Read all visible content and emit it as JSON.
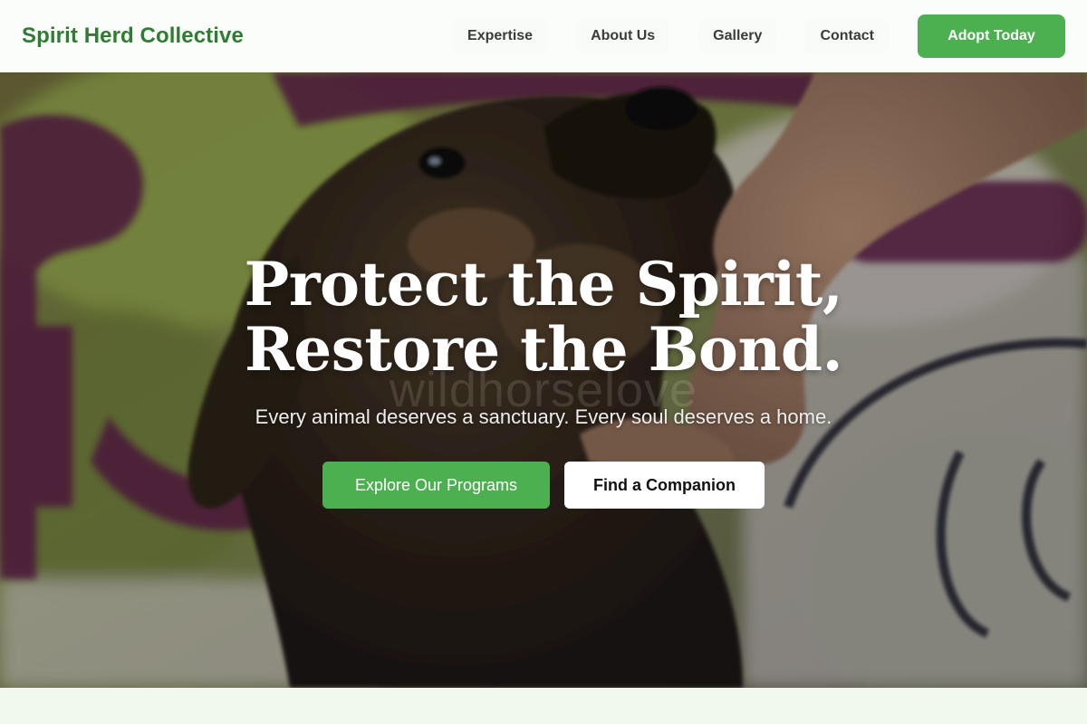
{
  "header": {
    "brand": "Spirit Herd Collective",
    "nav": [
      "Expertise",
      "About Us",
      "Gallery",
      "Contact"
    ],
    "cta_label": "Adopt Today"
  },
  "hero": {
    "title_line1": "Protect the Spirit,",
    "title_line2": "Restore the Bond.",
    "watermark": "wildhorselove",
    "subtitle": "Every animal deserves a sanctuary. Every soul deserves a home.",
    "primary_cta": "Explore Our Programs",
    "secondary_cta": "Find a Companion"
  },
  "colors": {
    "brand_green": "#2e7d32",
    "accent_green": "#4caf50",
    "section_bg": "#f1f8ec"
  }
}
